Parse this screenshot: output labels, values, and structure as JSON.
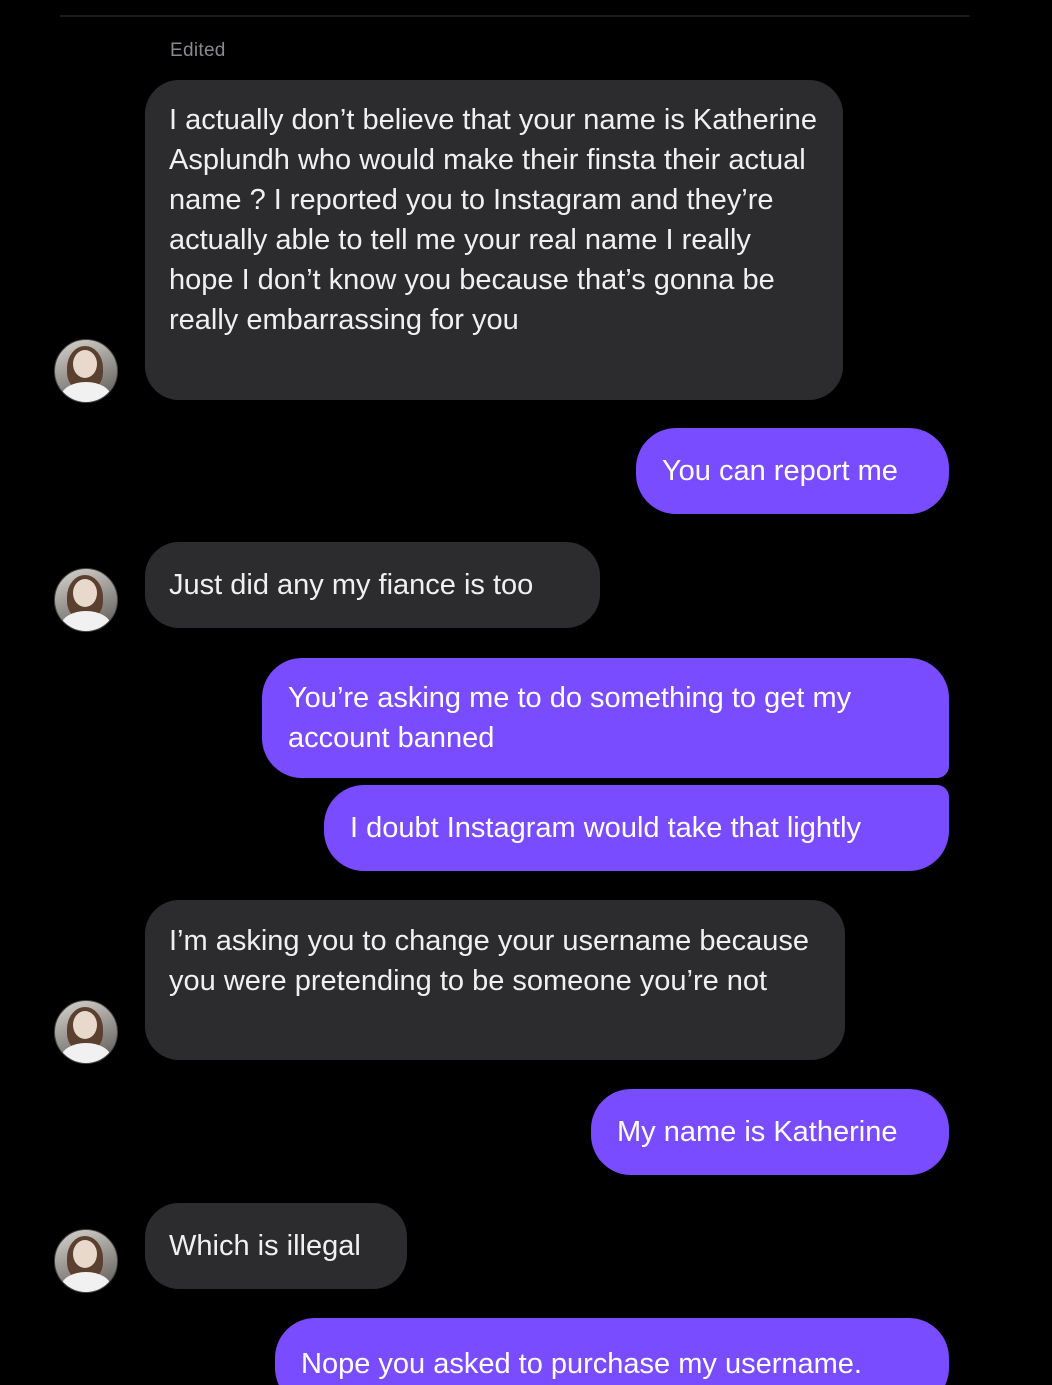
{
  "thread": {
    "edited_label": "Edited",
    "messages": [
      {
        "sender": "them",
        "text": "I actually don’t believe that your name is Katherine Asplundh who would make their finsta their actual name ? I reported you to Instagram and they’re actually able to tell me your real name I really hope I don’t know you because that’s gonna be really embarrassing for you"
      },
      {
        "sender": "me",
        "text": "You can report me"
      },
      {
        "sender": "them",
        "text": "Just did any my fiance is too"
      },
      {
        "sender": "me",
        "text": "You’re asking me to do something to get my account banned"
      },
      {
        "sender": "me",
        "text": "I doubt Instagram would take that lightly"
      },
      {
        "sender": "them",
        "text": "I’m asking you to change your username because you were pretending to be someone you’re not"
      },
      {
        "sender": "me",
        "text": "My name is Katherine"
      },
      {
        "sender": "them",
        "text": "Which is illegal"
      },
      {
        "sender": "me",
        "text": "Nope you asked to purchase my username."
      }
    ]
  },
  "colors": {
    "background": "#000000",
    "incoming_bubble": "#2c2c2e",
    "outgoing_bubble": "#7a4cff",
    "text": "#f0f0f2"
  }
}
